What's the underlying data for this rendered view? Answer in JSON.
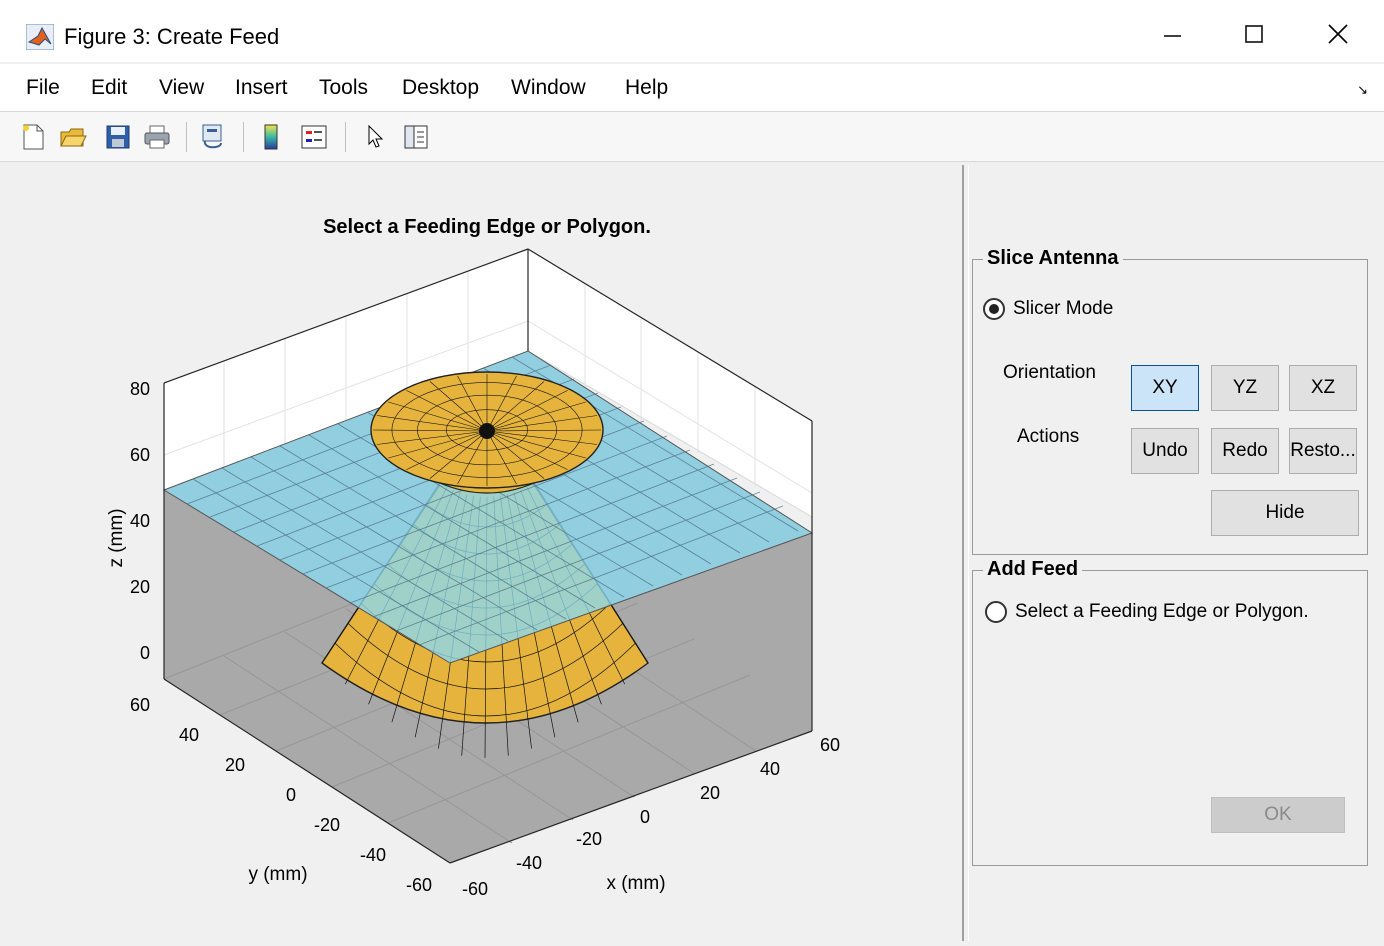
{
  "window": {
    "title": "Figure 3: Create Feed"
  },
  "menu": {
    "items": [
      "File",
      "Edit",
      "View",
      "Insert",
      "Tools",
      "Desktop",
      "Window",
      "Help"
    ]
  },
  "toolbar": {
    "icons": [
      "new-figure-icon",
      "open-file-icon",
      "save-icon",
      "print-icon",
      "link-plot-icon",
      "colorbar-icon",
      "legend-icon",
      "edit-plot-icon",
      "property-inspector-icon"
    ]
  },
  "plot": {
    "title": "Select a Feeding Edge or Polygon.",
    "xlabel": "x (mm)",
    "ylabel": "y (mm)",
    "zlabel": "z (mm)",
    "z_ticks": [
      "80",
      "60",
      "40",
      "20",
      "0"
    ],
    "y_ticks": [
      "60",
      "40",
      "20",
      "0",
      "-20",
      "-40",
      "-60"
    ],
    "x_ticks": [
      "-60",
      "-40",
      "-20",
      "0",
      "20",
      "40",
      "60"
    ],
    "colors": {
      "cone": "#e6b43c",
      "slice_plane": "#8ad8f0",
      "shadow": "#a8a8a8"
    }
  },
  "slice_panel": {
    "title": "Slice Antenna",
    "slicer_mode_label": "Slicer Mode",
    "slicer_mode_selected": true,
    "orientation_label": "Orientation",
    "actions_label": "Actions",
    "orientation_buttons": [
      "XY",
      "YZ",
      "XZ"
    ],
    "selected_orientation": "XY",
    "undo": "Undo",
    "redo": "Redo",
    "restore": "Resto...",
    "hide": "Hide"
  },
  "feed_panel": {
    "title": "Add Feed",
    "option_label": "Select a Feeding Edge or Polygon.",
    "option_selected": false,
    "ok": "OK"
  }
}
